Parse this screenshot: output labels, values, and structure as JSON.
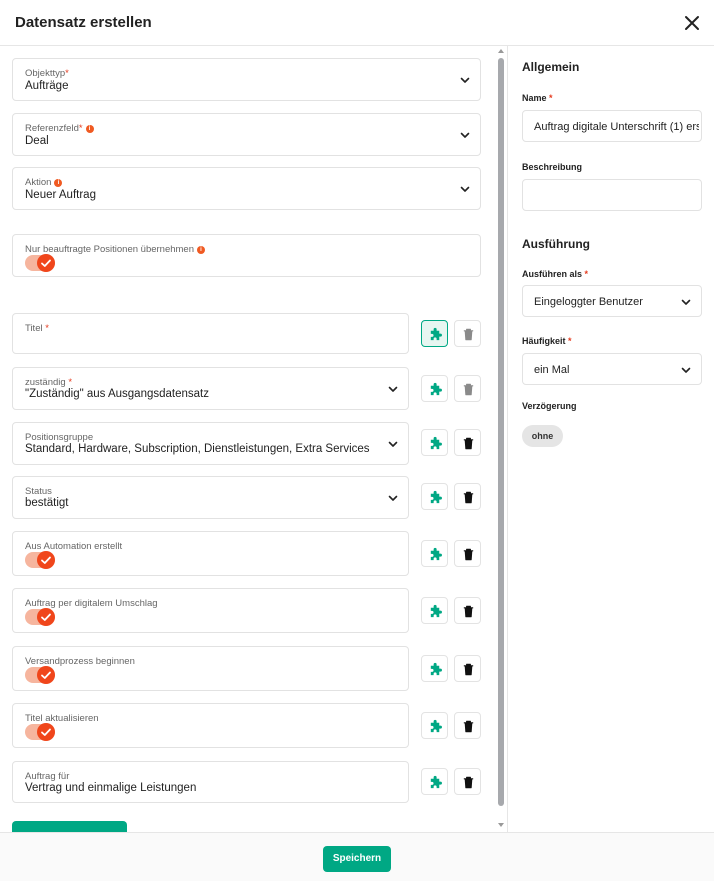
{
  "header": {
    "title": "Datensatz erstellen"
  },
  "left": {
    "objekttyp": {
      "label": "Objekttyp",
      "value": "Aufträge"
    },
    "referenzfeld": {
      "label": "Referenzfeld",
      "value": "Deal"
    },
    "aktion": {
      "label": "Aktion",
      "value": "Neuer Auftrag"
    },
    "nur_beauftragte": {
      "label": "Nur beauftragte Positionen übernehmen",
      "checked": true
    },
    "fields": [
      {
        "label": "Titel",
        "required": true,
        "value": "",
        "type": "text"
      },
      {
        "label": "zuständig",
        "required": true,
        "value": "\"Zuständig\" aus Ausgangsdatensatz",
        "type": "select"
      },
      {
        "label": "Positionsgruppe",
        "required": false,
        "value": "Standard, Hardware, Subscription, Dienstleistungen, Extra Services",
        "type": "select"
      },
      {
        "label": "Status",
        "required": false,
        "value": "bestätigt",
        "type": "select"
      },
      {
        "label": "Aus Automation erstellt",
        "required": false,
        "type": "toggle",
        "checked": true
      },
      {
        "label": "Auftrag per digitalem Umschlag",
        "required": false,
        "type": "toggle",
        "checked": true
      },
      {
        "label": "Versandprozess beginnen",
        "required": false,
        "type": "toggle",
        "checked": true
      },
      {
        "label": "Titel aktualisieren",
        "required": false,
        "type": "toggle",
        "checked": true
      },
      {
        "label": "Auftrag für",
        "required": false,
        "value": "Vertrag und einmalige Leistungen",
        "type": "text"
      }
    ]
  },
  "right": {
    "allgemein_title": "Allgemein",
    "name_label": "Name",
    "name_value": "Auftrag digitale Unterschrift (1) ers",
    "beschreibung_label": "Beschreibung",
    "beschreibung_value": "",
    "ausfuehrung_title": "Ausführung",
    "ausfuehren_als_label": "Ausführen als",
    "ausfuehren_als_value": "Eingeloggter Benutzer",
    "haeufigkeit_label": "Häufigkeit",
    "haeufigkeit_value": "ein Mal",
    "verzoegerung_label": "Verzögerung",
    "verzoegerung_value": "ohne"
  },
  "footer": {
    "save_label": "Speichern"
  },
  "colors": {
    "accent": "#00a884",
    "toggle": "#f0461b",
    "required": "#e53b1f"
  },
  "icons": {
    "close": "close-icon",
    "chevron": "chevron-down-icon",
    "puzzle": "puzzle-icon",
    "trash": "trash-icon"
  }
}
